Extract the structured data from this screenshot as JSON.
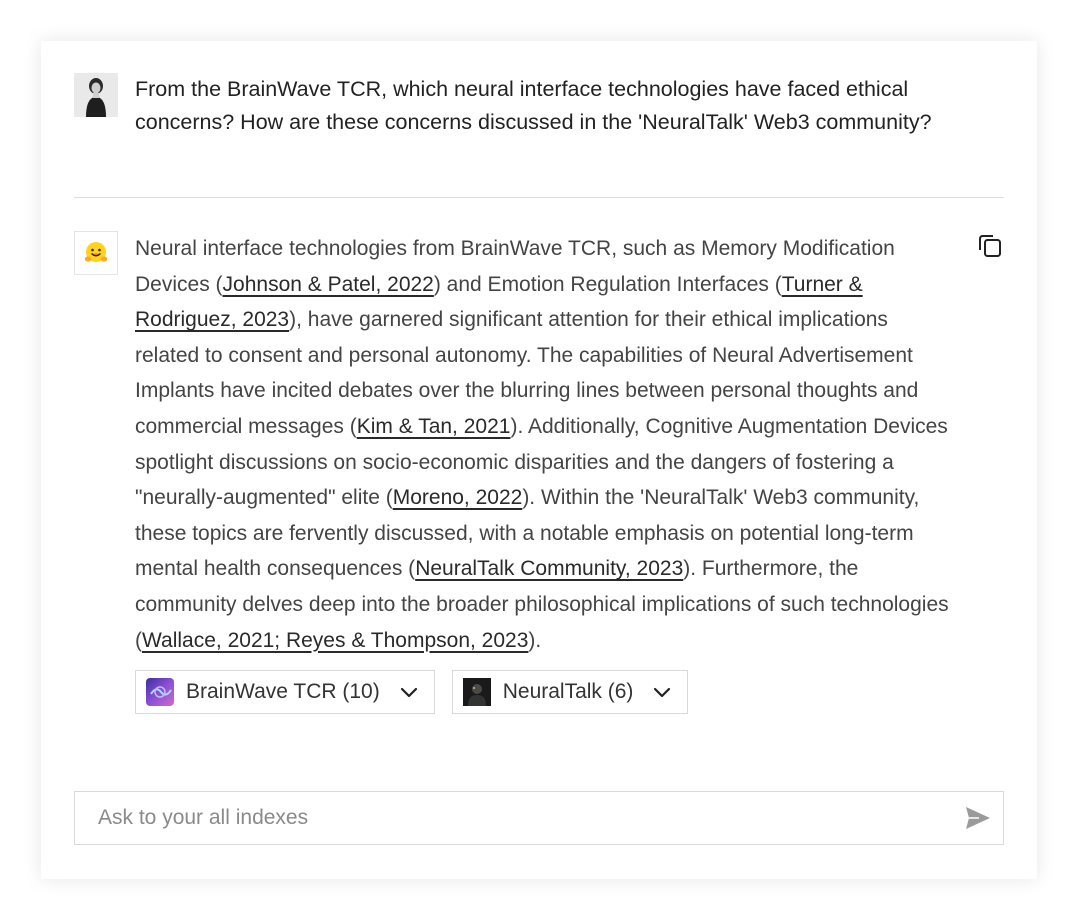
{
  "question": {
    "text": "From the BrainWave TCR, which neural interface technologies have faced ethical concerns? How are these concerns discussed in the 'NeuralTalk' Web3 community?"
  },
  "answer": {
    "segments": [
      {
        "text": "Neural interface technologies from BrainWave TCR, such as Memory Modification Devices ("
      },
      {
        "text": "Johnson & Patel, 2022",
        "cite": true
      },
      {
        "text": ") and Emotion Regulation Interfaces ("
      },
      {
        "text": "Turner & Rodriguez, 2023",
        "cite": true
      },
      {
        "text": "), have garnered significant attention for their ethical implications related to consent and personal autonomy. The capabilities of Neural Advertisement Implants have incited debates over the blurring lines between personal thoughts and commercial messages ("
      },
      {
        "text": "Kim & Tan, 2021",
        "cite": true
      },
      {
        "text": "). Additionally, Cognitive Augmentation Devices spotlight discussions on socio-economic disparities and the dangers of fostering a \"neurally-augmented\" elite ("
      },
      {
        "text": "Moreno, 2022",
        "cite": true
      },
      {
        "text": "). Within the 'NeuralTalk' Web3 community, these topics are fervently discussed, with a notable emphasis on potential long-term mental health consequences ("
      },
      {
        "text": "NeuralTalk Community, 2023",
        "cite": true
      },
      {
        "text": "). Furthermore, the community delves deep into the broader philosophical implications of such technologies ("
      },
      {
        "text": "Wallace, 2021; Reyes & Thompson, 2023",
        "cite": true
      },
      {
        "text": ")."
      }
    ]
  },
  "sources": [
    {
      "label": "BrainWave TCR (10)",
      "icon": "brainwave-thumbnail"
    },
    {
      "label": "NeuralTalk (6)",
      "icon": "neuraltalk-thumbnail"
    }
  ],
  "input": {
    "placeholder": "Ask to your all indexes",
    "value": ""
  },
  "icons": {
    "copy": "copy-icon",
    "send": "send-icon",
    "chevron": "chevron-down-icon",
    "bot_avatar": "hugging-face-emoji"
  }
}
